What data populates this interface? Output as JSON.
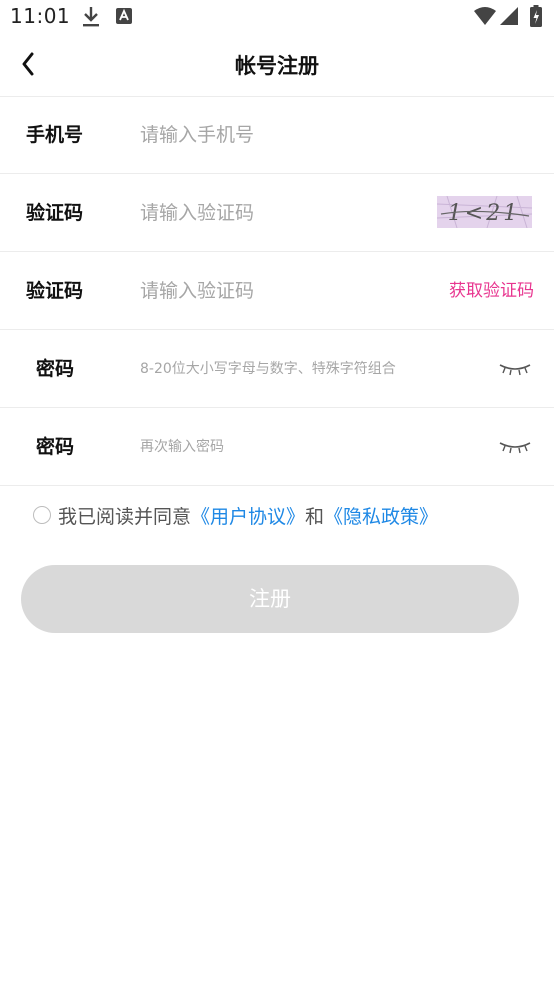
{
  "status_bar": {
    "time": "11:01",
    "icons": [
      "download-icon",
      "app-notification-icon",
      "wifi-icon",
      "signal-icon",
      "battery-icon"
    ]
  },
  "header": {
    "title": "帐号注册",
    "back_icon": "chevron-left-icon"
  },
  "form": {
    "phone": {
      "label": "手机号",
      "placeholder": "请输入手机号",
      "value": ""
    },
    "captcha": {
      "label": "验证码",
      "placeholder": "请输入验证码",
      "value": "",
      "image_text": "1<21"
    },
    "sms_code": {
      "label": "验证码",
      "placeholder": "请输入验证码",
      "value": "",
      "button_label": "获取验证码",
      "button_color": "#e8358f"
    },
    "password": {
      "label": "密码",
      "placeholder": "8-20位大小写字母与数字、特殊字符组合",
      "value": "",
      "toggle_icon": "eye-closed-icon"
    },
    "password_confirm": {
      "label": "密码",
      "placeholder": "再次输入密码",
      "value": "",
      "toggle_icon": "eye-closed-icon"
    }
  },
  "agreement": {
    "prefix": "我已阅读并同意",
    "user_agreement": "《用户协议》",
    "and": "和",
    "privacy_policy": "《隐私政策》",
    "checked": false,
    "link_color": "#1e88e5"
  },
  "submit": {
    "label": "注册",
    "enabled": false
  }
}
